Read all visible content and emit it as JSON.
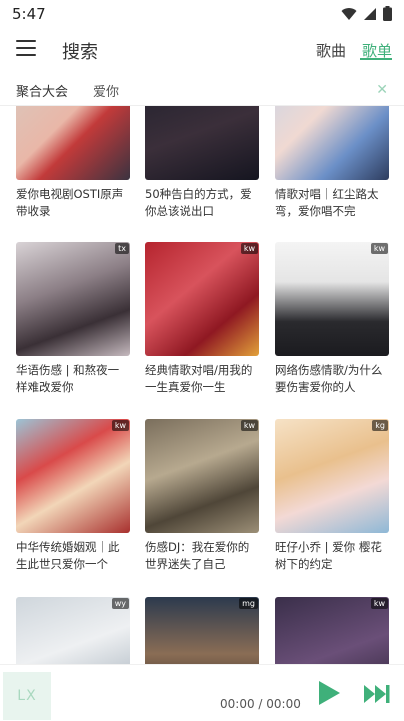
{
  "status": {
    "time": "5:47"
  },
  "header": {
    "title": "搜索",
    "tabs": [
      {
        "label": "歌曲"
      },
      {
        "label": "歌单"
      }
    ]
  },
  "search": {
    "source": "聚合大会",
    "query": "爱你",
    "clear_icon": "close-icon"
  },
  "playlists": [
    {
      "name": "爱你电视剧OSTI原声带收录",
      "source": ""
    },
    {
      "name": "50种告白的方式，爱你总该说出口",
      "source": ""
    },
    {
      "name": "情歌对唱｜红尘路太弯，爱你唱不完",
      "source": ""
    },
    {
      "name": "华语伤感 | 和熬夜一样难改爱你",
      "source": "tx"
    },
    {
      "name": "经典情歌对唱/用我的一生真爱你一生",
      "source": "kw"
    },
    {
      "name": "网络伤感情歌/为什么要伤害爱你的人",
      "source": "kw"
    },
    {
      "name": "中华传统婚姻观｜此生此世只爱你一个",
      "source": "kw"
    },
    {
      "name": "伤感DJ：我在爱你的世界迷失了自己",
      "source": "kw"
    },
    {
      "name": "旺仔小乔 | 爱你 樱花树下的约定",
      "source": "kg"
    },
    {
      "name": "",
      "source": "wy"
    },
    {
      "name": "",
      "source": "mg"
    },
    {
      "name": "",
      "source": "kw"
    }
  ],
  "player": {
    "logo": "LX",
    "time": "00:00 / 00:00"
  },
  "colors": {
    "accent": "#3fb07a"
  }
}
